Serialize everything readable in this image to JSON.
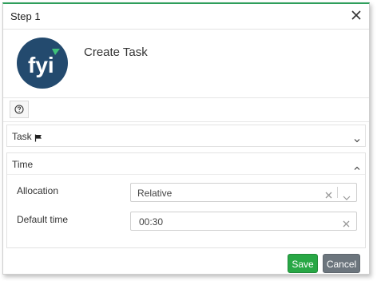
{
  "dialog": {
    "title": "Step 1"
  },
  "app": {
    "name": "Create Task",
    "logo_text": "fyi"
  },
  "sections": {
    "task": {
      "label": "Task",
      "expanded": false
    },
    "time": {
      "label": "Time",
      "expanded": true
    }
  },
  "fields": {
    "allocation": {
      "label": "Allocation",
      "value": "Relative"
    },
    "default_time": {
      "label": "Default time",
      "value": "00:30"
    }
  },
  "footer": {
    "save_label": "Save",
    "cancel_label": "Cancel"
  },
  "colors": {
    "accent": "#2e9e5b",
    "save": "#28a745",
    "cancel": "#6c757d",
    "logo_bg": "#234a6e"
  },
  "icons": [
    "close-icon",
    "help-icon",
    "flag-icon",
    "chevron-down-icon",
    "chevron-up-icon",
    "clear-icon",
    "dropdown-arrow-icon"
  ]
}
